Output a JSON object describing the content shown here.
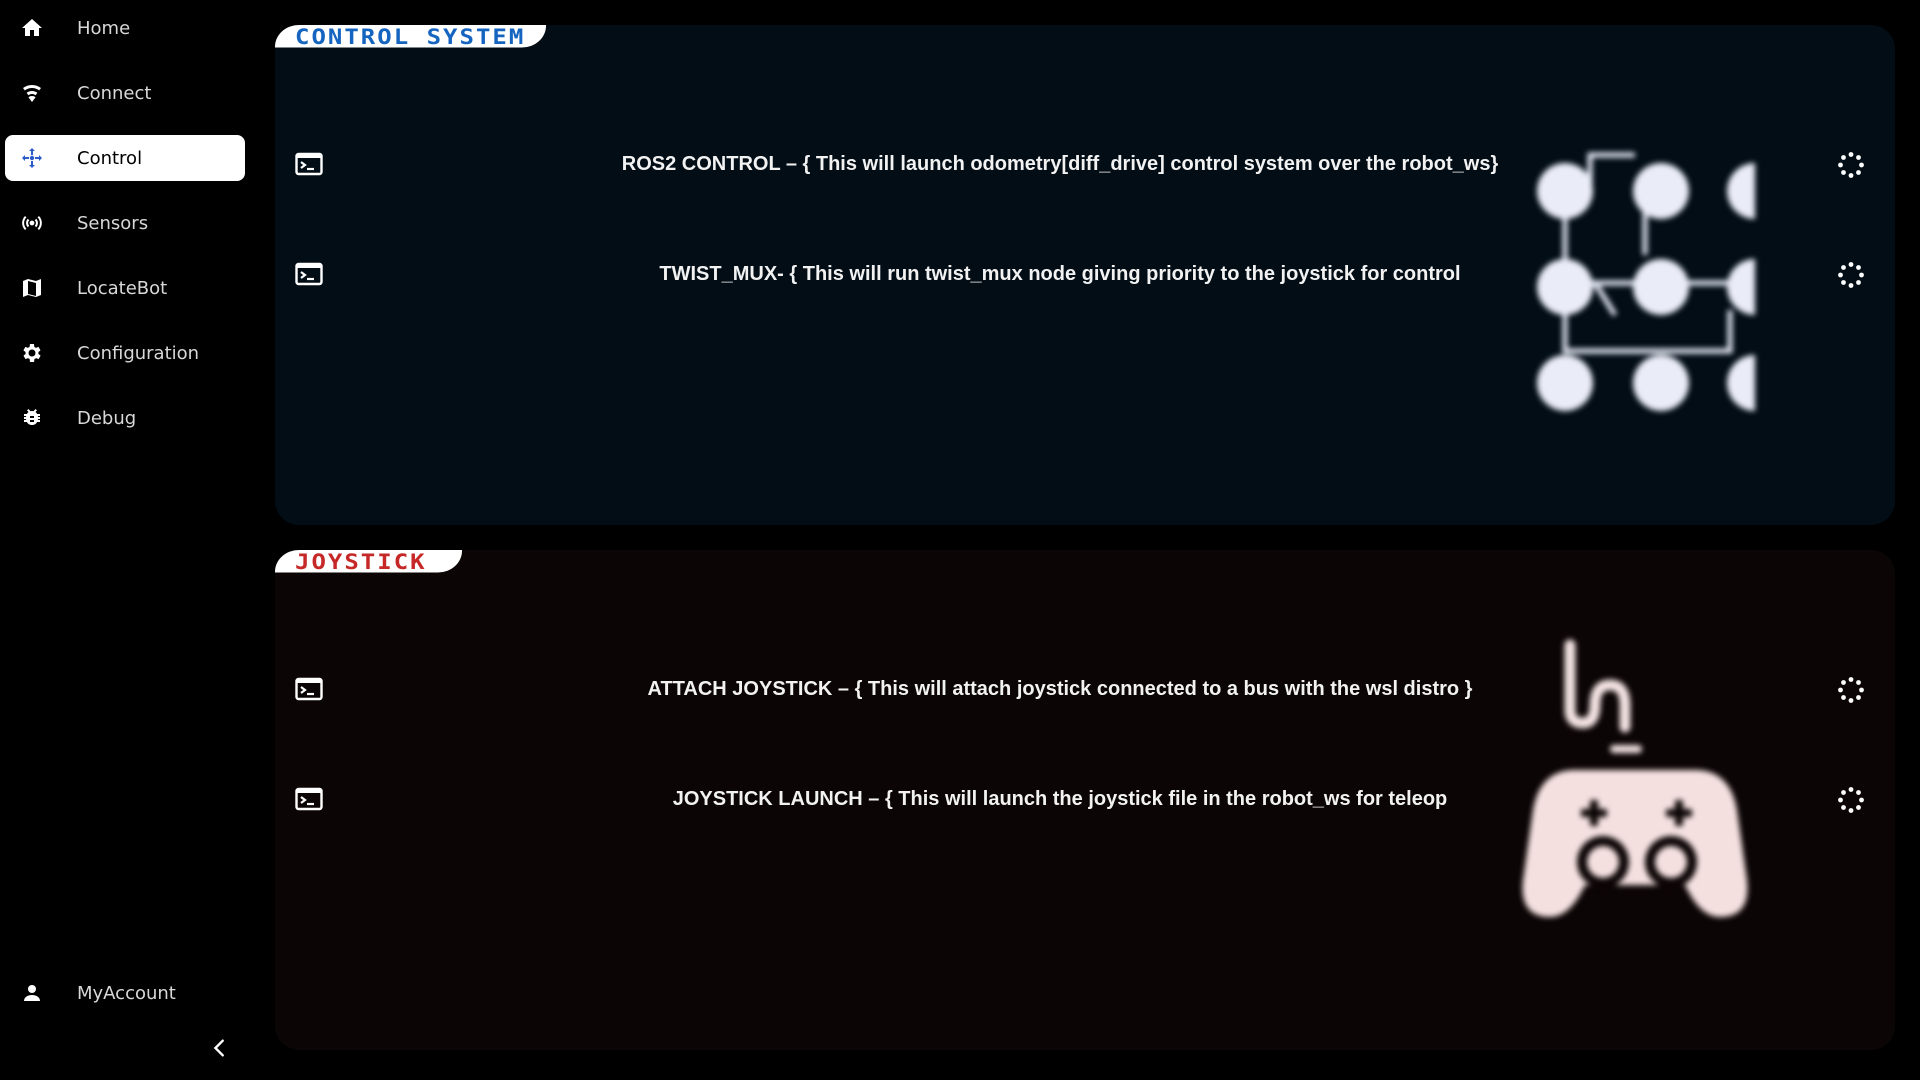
{
  "sidebar": {
    "items": [
      {
        "label": "Home",
        "icon": "home-icon"
      },
      {
        "label": "Connect",
        "icon": "wifi-icon"
      },
      {
        "label": "Control",
        "icon": "move-arrows-icon",
        "active": true
      },
      {
        "label": "Sensors",
        "icon": "radio-broadcast-icon"
      },
      {
        "label": "LocateBot",
        "icon": "map-icon"
      },
      {
        "label": "Configuration",
        "icon": "gear-icon"
      },
      {
        "label": "Debug",
        "icon": "bug-icon"
      }
    ],
    "account": {
      "label": "MyAccount",
      "icon": "person-icon"
    },
    "collapse_icon": "chevron-left-icon",
    "active_color": "#2d5ec7"
  },
  "control_panel": {
    "title": "CONTROL SYSTEM",
    "title_color": "#1565c0",
    "background": "#020d16",
    "decoration_icon": "network-grid-icon",
    "rows": [
      {
        "text": "ROS2 CONTROL – { This will launch odometry[diff_drive] control system over the robot_ws}",
        "left_icon": "terminal-icon",
        "right_icon": "loading-spinner-icon"
      },
      {
        "text": "TWIST_MUX- { This will run twist_mux node giving priority to the joystick for control",
        "left_icon": "terminal-icon",
        "right_icon": "loading-spinner-icon"
      }
    ]
  },
  "joystick_panel": {
    "title": "JOYSTICK",
    "title_color": "#c62828",
    "background": "#0c0505",
    "decoration_icon": "gamepad-icon",
    "rows": [
      {
        "text": "ATTACH JOYSTICK – { This will attach joystick connected to a bus with the wsl distro }",
        "left_icon": "terminal-icon",
        "right_icon": "loading-spinner-icon"
      },
      {
        "text": "JOYSTICK LAUNCH – { This will launch the joystick file in the robot_ws for teleop",
        "left_icon": "terminal-icon",
        "right_icon": "loading-spinner-icon"
      }
    ]
  }
}
